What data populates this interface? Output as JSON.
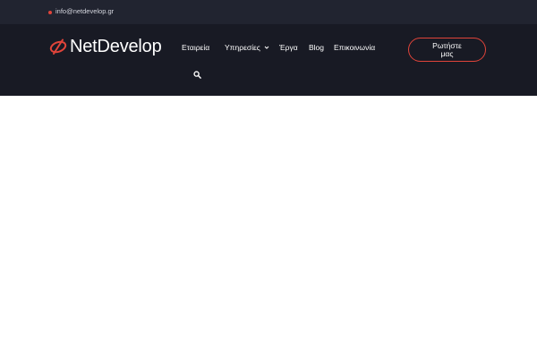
{
  "topbar": {
    "email": "info@netdevelop.gr",
    "dot_color": "#e0443a"
  },
  "header": {
    "logo": {
      "text": "NetDevelop",
      "icon": "netdevelop-logo-icon"
    },
    "nav": [
      {
        "label": "Εταιρεία",
        "has_dropdown": false
      },
      {
        "label": "Υπηρεσίες",
        "has_dropdown": true,
        "icon": "chevron-down-icon"
      },
      {
        "label": "Έργα",
        "has_dropdown": false
      },
      {
        "label": "Blog",
        "has_dropdown": false
      },
      {
        "label": "Επικοινωνία",
        "has_dropdown": false
      }
    ],
    "search_icon": "search-icon",
    "cta_label": "Ρωτήστε μας"
  },
  "colors": {
    "topbar_bg": "#212430",
    "header_bg": "#181a24",
    "accent": "#e0443a",
    "text": "#ffffff",
    "content_bg": "#ffffff"
  }
}
